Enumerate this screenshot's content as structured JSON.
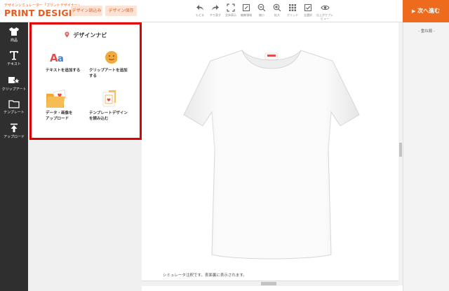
{
  "header": {
    "logo_sub": "デザインシミュレーター「プリントデザイナー」",
    "logo_main": "PRINT DESIGNER",
    "load_label": "デザイン読込み",
    "save_label": "デザイン保存",
    "next_label": "次へ進む",
    "next_arrow": "▶"
  },
  "toolbar": {
    "items": [
      {
        "label": "もどる",
        "icon": "undo-icon"
      },
      {
        "label": "やり直す",
        "icon": "redo-icon"
      },
      {
        "label": "全体表示",
        "icon": "fit-screen-icon"
      },
      {
        "label": "編集領域",
        "icon": "edit-area-icon"
      },
      {
        "label": "縮小",
        "icon": "zoom-out-icon"
      },
      {
        "label": "拡大",
        "icon": "zoom-in-icon"
      },
      {
        "label": "グリッド",
        "icon": "grid-icon"
      },
      {
        "label": "全選択",
        "icon": "select-all-icon"
      },
      {
        "label": "仕上がりプレビュー",
        "icon": "preview-eye-icon"
      }
    ]
  },
  "sidebar": {
    "items": [
      {
        "label": "商品",
        "icon": "tshirt-icon"
      },
      {
        "label": "テキスト",
        "icon": "text-icon"
      },
      {
        "label": "クリップアート",
        "icon": "clipart-icon"
      },
      {
        "label": "テンプレート",
        "icon": "folder-icon"
      },
      {
        "label": "アップロード",
        "icon": "upload-icon"
      }
    ]
  },
  "design_nav": {
    "title": "デザインナビ",
    "items": [
      {
        "lines": [
          "テキストを追加する"
        ],
        "icon": "text-aa-icon"
      },
      {
        "lines": [
          "クリップアートを追加",
          "する"
        ],
        "icon": "smiley-icon"
      },
      {
        "lines": [
          "データ・画像を",
          "アップロード"
        ],
        "icon": "upload-folder-icon"
      },
      {
        "lines": [
          "テンプレートデザイン",
          "を読み込む"
        ],
        "icon": "template-icon"
      }
    ]
  },
  "canvas": {
    "footnote": "シミュレータ注釈です。表面裏に表示されます。"
  },
  "right_panel": {
    "layer_label": "- 重ね順 -"
  },
  "colors": {
    "brand_orange": "#e85a1d",
    "next_button": "#ee6a1c",
    "highlight_red": "#e00000",
    "sidebar_dark": "#2f2f2f"
  }
}
